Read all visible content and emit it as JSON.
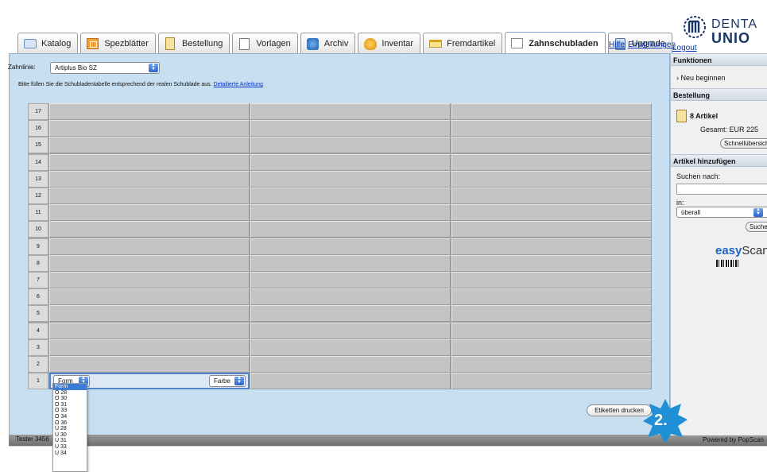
{
  "tabs": [
    {
      "label": "Katalog",
      "icon": "catalog-box-icon"
    },
    {
      "label": "Spezblätter",
      "icon": "grid-sheet-icon"
    },
    {
      "label": "Bestellung",
      "icon": "clipboard-icon"
    },
    {
      "label": "Vorlagen",
      "icon": "template-doc-icon"
    },
    {
      "label": "Archiv",
      "icon": "archive-cube-icon"
    },
    {
      "label": "Inventar",
      "icon": "inventory-bag-icon"
    },
    {
      "label": "Fremdartikel",
      "icon": "card-icon"
    },
    {
      "label": "Zahnschubladen",
      "icon": "drawer-icon",
      "active": true
    },
    {
      "label": "Upgrade",
      "icon": "upgrade-icon"
    }
  ],
  "header": {
    "links": [
      "Hilfe",
      "Einstellungen",
      "Logout"
    ],
    "logo_line1": "DENTA",
    "logo_line2": "UNIO"
  },
  "form": {
    "zahnlinie_label": "Zahnlinie:",
    "zahnlinie_value": "Artiplus Bio SZ",
    "instruction": "Bitte füllen Sie die Schubladentabelle entsprechend der realen Schublade aus.",
    "instruction_link": "Detailierte Anleitung"
  },
  "table": {
    "rows": [
      "17",
      "16",
      "15",
      "14",
      "13",
      "12",
      "11",
      "10",
      "9",
      "8",
      "7",
      "6",
      "5",
      "4",
      "3",
      "2",
      "1"
    ],
    "form_select": "Form",
    "farbe_select": "Farbe"
  },
  "dropdown_options": [
    "Form",
    "O 28",
    "O 30",
    "O 31",
    "O 33",
    "O 34",
    "O 36",
    "U 28",
    "U 30",
    "U 31",
    "U 33",
    "U 34"
  ],
  "buttons": {
    "etiketten": "Etiketten drucken"
  },
  "badge": "2.",
  "status": {
    "user": "Tester 3456",
    "powered": "Powered by PopScan"
  },
  "sidebar": {
    "funktionen": "Funktionen",
    "neu_beginnen": "› Neu beginnen",
    "bestellung": "Bestellung",
    "artikel_count": "8 Artikel",
    "gesamt": "Gesamt: EUR 225",
    "schnell_btn": "Schnellübersicht",
    "artikel_hinzufuegen": "Artikel hinzufügen",
    "suchen_nach": "Suchen nach:",
    "in_label": "in:",
    "in_value": "überall",
    "suchen_btn": "Suchen",
    "easy": "easy",
    "scan": "Scan"
  },
  "colors": {
    "panel_bg": "#c7dff0",
    "badge": "#1f8fd6",
    "link": "#0033aa"
  }
}
